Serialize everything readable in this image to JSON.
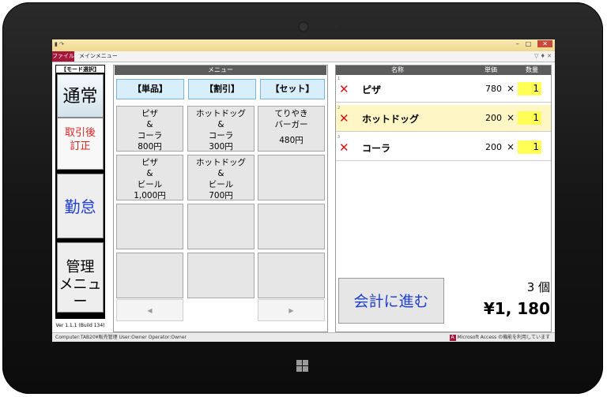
{
  "window": {
    "tab_file": "ファイル",
    "tab_main": "メインメニュー",
    "tabright": "▽ ♦ ✕",
    "qat": "▮ ↷",
    "btn_min": "–",
    "btn_max": "□",
    "btn_close": "✕"
  },
  "mode_panel": {
    "label": "【モード選択】",
    "normal": "通常",
    "correct_l1": "取引後",
    "correct_l2": "訂正",
    "attendance": "勤怠",
    "admin_l1": "管理",
    "admin_l2": "メニュー",
    "version": "Ver 1.1.1 (Build 134)"
  },
  "menu": {
    "header": "メニュー",
    "categories": [
      "【単品】",
      "【割引】",
      "【セット】"
    ],
    "items": [
      {
        "lines": [
          "ピザ",
          "&",
          "コーラ",
          "800円"
        ]
      },
      {
        "lines": [
          "ホットドッグ",
          "&",
          "コーラ",
          "300円"
        ]
      },
      {
        "lines": [
          "てりやき",
          "バーガー",
          "",
          "480円"
        ]
      },
      {
        "lines": [
          "ピザ",
          "&",
          "ビール",
          "1,000円"
        ]
      },
      {
        "lines": [
          "ホットドッグ",
          "&",
          "ビール",
          "700円"
        ]
      },
      {
        "lines": []
      }
    ],
    "prev": "◀",
    "next": "▶"
  },
  "order": {
    "col_name": "名称",
    "col_price": "単価",
    "col_qty": "数量",
    "rows": [
      {
        "num": "1",
        "name": "ピザ",
        "price": "780",
        "times": "×",
        "qty": "1"
      },
      {
        "num": "2",
        "name": "ホットドッグ",
        "price": "200",
        "times": "×",
        "qty": "1"
      },
      {
        "num": "3",
        "name": "コーラ",
        "price": "200",
        "times": "×",
        "qty": "1"
      }
    ],
    "checkout": "会計に進む",
    "count": "3 個",
    "total": "¥1, 180"
  },
  "status": {
    "left": "Computer:TAB20¥販売管理 User:Owner Operator:Owner",
    "right": "Microsoft Access の機能を利用しています",
    "access_icon": "A"
  },
  "colors": {
    "accent_red": "#e01010",
    "accent_blue": "#1f3fd0",
    "qty_yellow": "#ffff55",
    "selected_row": "#fff6c5"
  }
}
